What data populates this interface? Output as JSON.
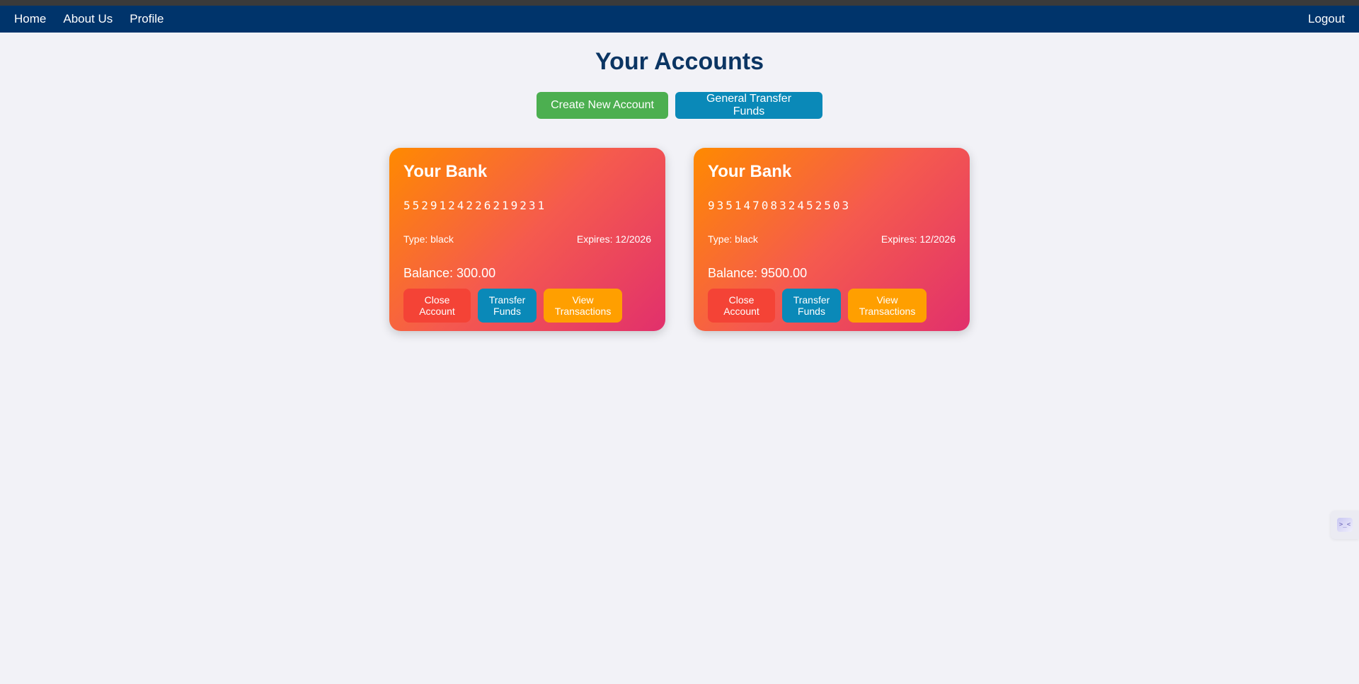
{
  "navbar": {
    "links": [
      {
        "label": "Home"
      },
      {
        "label": "About Us"
      },
      {
        "label": "Profile"
      }
    ],
    "logout_label": "Logout"
  },
  "page": {
    "title": "Your Accounts",
    "create_button": "Create New Account",
    "general_transfer_button": "General Transfer Funds"
  },
  "accounts": [
    {
      "bank": "Your Bank",
      "number": "5529124226219231",
      "type": "Type: black",
      "expires": "Expires: 12/2026",
      "balance": "Balance: 300.00",
      "close_label": "Close Account",
      "transfer_label": "Transfer Funds",
      "view_label": "View Transactions"
    },
    {
      "bank": "Your Bank",
      "number": "9351470832452503",
      "type": "Type: black",
      "expires": "Expires: 12/2026",
      "balance": "Balance: 9500.00",
      "close_label": "Close Account",
      "transfer_label": "Transfer Funds",
      "view_label": "View Transactions"
    }
  ],
  "colors": {
    "navbar": "#00346b",
    "title": "#0b3563",
    "create": "#4caf50",
    "transfer": "#0a89b8",
    "close": "#f44336",
    "view": "#ff9f00"
  },
  "side_widget": {
    "icon": "terminal-widget-icon",
    "glyph": ">_<"
  }
}
